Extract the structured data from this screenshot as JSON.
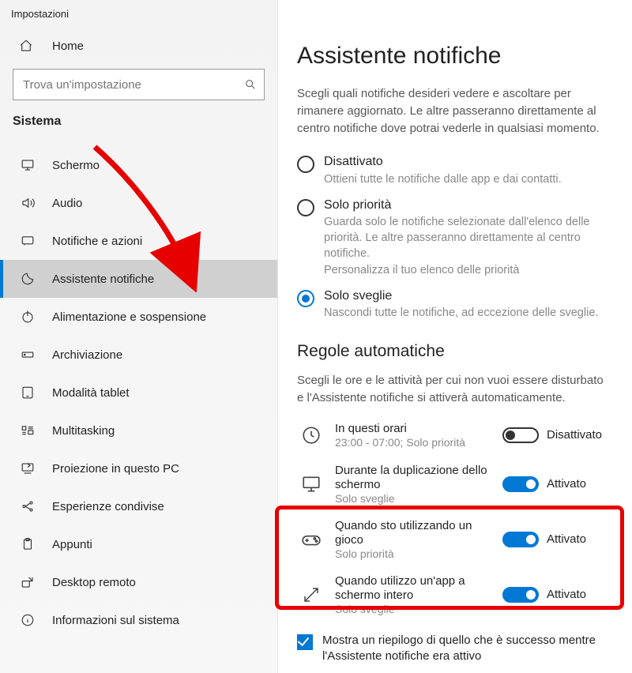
{
  "window_title": "Impostazioni",
  "home_label": "Home",
  "search_placeholder": "Trova un'impostazione",
  "group_title": "Sistema",
  "sidebar": {
    "items": [
      {
        "label": "Schermo"
      },
      {
        "label": "Audio"
      },
      {
        "label": "Notifiche e azioni"
      },
      {
        "label": "Assistente notifiche"
      },
      {
        "label": "Alimentazione e sospensione"
      },
      {
        "label": "Archiviazione"
      },
      {
        "label": "Modalità tablet"
      },
      {
        "label": "Multitasking"
      },
      {
        "label": "Proiezione in questo PC"
      },
      {
        "label": "Esperienze condivise"
      },
      {
        "label": "Appunti"
      },
      {
        "label": "Desktop remoto"
      },
      {
        "label": "Informazioni sul sistema"
      }
    ]
  },
  "main": {
    "title": "Assistente notifiche",
    "intro": "Scegli quali notifiche desideri vedere e ascoltare per rimanere aggiornato. Le altre passeranno direttamente al centro notifiche dove potrai vederle in qualsiasi momento.",
    "options": [
      {
        "label": "Disattivato",
        "sub": "Ottieni tutte le notifiche dalle app e dai contatti."
      },
      {
        "label": "Solo priorità",
        "sub": "Guarda solo le notifiche selezionate dall'elenco delle priorità. Le altre passeranno direttamente al centro notifiche.",
        "link": "Personalizza il tuo elenco delle priorità"
      },
      {
        "label": "Solo sveglie",
        "sub": "Nascondi tutte le notifiche, ad eccezione delle sveglie."
      }
    ],
    "rules_title": "Regole automatiche",
    "rules_intro": "Scegli le ore e le attività per cui non vuoi essere disturbato e l'Assistente notifiche si attiverà automaticamente.",
    "rules": [
      {
        "title": "In questi orari",
        "sub": "23:00 - 07:00; Solo priorità",
        "state": "Disattivato",
        "on": false
      },
      {
        "title": "Durante la duplicazione dello schermo",
        "sub": "Solo sveglie",
        "state": "Attivato",
        "on": true
      },
      {
        "title": "Quando sto utilizzando un gioco",
        "sub": "Solo priorità",
        "state": "Attivato",
        "on": true
      },
      {
        "title": "Quando utilizzo un'app a schermo intero",
        "sub": "Solo sveglie",
        "state": "Attivato",
        "on": true
      }
    ],
    "summary_checkbox": "Mostra un riepilogo di quello che è successo mentre l'Assistente notifiche era attivo"
  }
}
